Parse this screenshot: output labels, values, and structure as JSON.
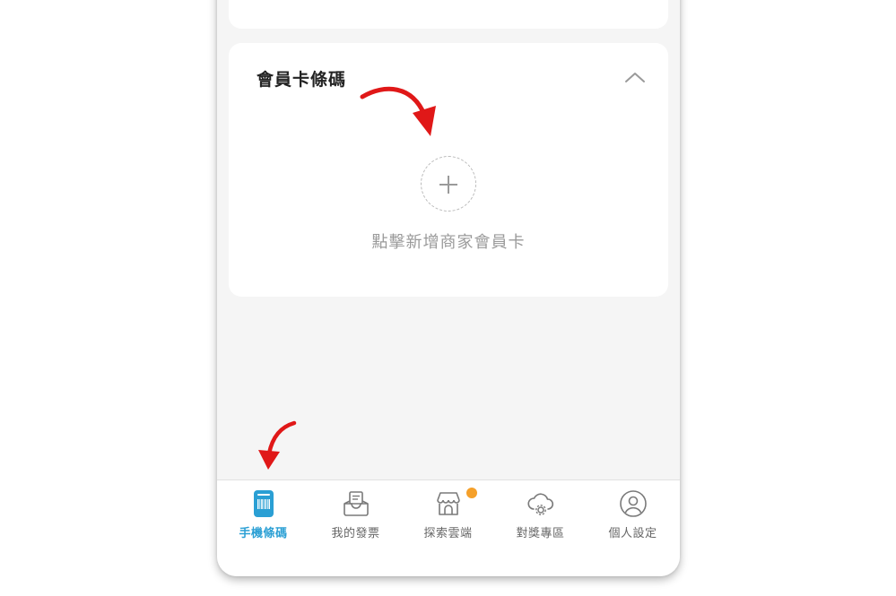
{
  "member_card": {
    "title": "會員卡條碼",
    "add_label": "點擊新增商家會員卡"
  },
  "tabs": [
    {
      "label": "手機條碼",
      "icon": "barcode-phone-icon",
      "active": true
    },
    {
      "label": "我的發票",
      "icon": "invoice-inbox-icon",
      "active": false
    },
    {
      "label": "探索雲端",
      "icon": "store-icon",
      "active": false,
      "badge": true
    },
    {
      "label": "對獎專區",
      "icon": "cloud-gear-icon",
      "active": false
    },
    {
      "label": "個人設定",
      "icon": "user-icon",
      "active": false
    }
  ],
  "colors": {
    "accent": "#2a9fd4",
    "badge": "#f5a02a",
    "annotation_arrow": "#e01818",
    "background": "#f5f5f5"
  }
}
